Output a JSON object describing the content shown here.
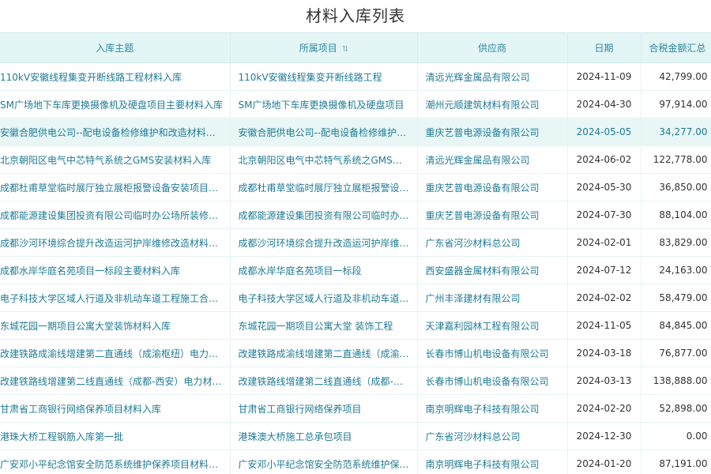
{
  "page": {
    "title": "材料入库列表"
  },
  "table": {
    "headers": {
      "theme": "入库主题",
      "project": "所属项目",
      "supplier": "供应商",
      "date": "日期",
      "amount": "合税金额汇总"
    },
    "sort_icon": "⇅",
    "rows": [
      {
        "theme": "110kV安徽线程集变开断线路工程材料入库",
        "project": "110kV安徽线程集变开断线路工程",
        "supplier": "清远光辉金属品有限公司",
        "date": "2024-11-09",
        "amount": "42,799.00"
      },
      {
        "theme": "SM广场地下车库更换摄像机及硬盘项目主要材料入库",
        "project": "SM广场地下车库更换摄像机及硬盘项目",
        "supplier": "潮州元顺建筑材料有限公司",
        "date": "2024-04-30",
        "amount": "97,914.00"
      },
      {
        "theme": "安徽合肥供电公司--配电设备检修维护和改造材料入库",
        "project": "安徽合肥供电公司--配电设备检修维护和改造",
        "supplier": "重庆艺普电源设备有限公司",
        "date": "2024-05-05",
        "amount": "34,277.00"
      },
      {
        "theme": "北京朝阳区电气中芯特气系统之GMS安装材料入库",
        "project": "北京朝阳区电气中芯特气系统之GMS安装",
        "supplier": "清远光辉金属品有限公司",
        "date": "2024-06-02",
        "amount": "122,778.00"
      },
      {
        "theme": "成都杜甫草堂临时展厅独立展柜报警设备安装项目材料入库",
        "project": "成都杜甫草堂临时展厅独立展柜报警设备安装项目",
        "supplier": "重庆艺普电源设备有限公司",
        "date": "2024-05-30",
        "amount": "36,850.00"
      },
      {
        "theme": "成都能源建设集团投资有限公司临时办公场所装修项目材料入库",
        "project": "成都能源建设集团投资有限公司临时办公场所装修项目",
        "supplier": "重庆艺普电源设备有限公司",
        "date": "2024-07-30",
        "amount": "88,104.00"
      },
      {
        "theme": "成都沙河环境综合提升改造运河护岸维修改造材料入库",
        "project": "成都沙河环境综合提升改造运河护岸维修改造",
        "supplier": "广东省河沙材料总公司",
        "date": "2024-02-01",
        "amount": "83,829.00"
      },
      {
        "theme": "成都水岸华庭名苑项目一标段主要材料入库",
        "project": "成都水岸华庭名苑项目一标段",
        "supplier": "西安盛器金属材料有限公司",
        "date": "2024-07-12",
        "amount": "24,163.00"
      },
      {
        "theme": "电子科技大学区域人行道及非机动车道工程施工合同材料入库",
        "project": "电子科技大学区域人行道及非机动车道工程施工合同",
        "supplier": "广州丰泽建材有限公司",
        "date": "2024-02-02",
        "amount": "58,479.00"
      },
      {
        "theme": "东城花园一期项目公寓大堂装饰材料入库",
        "project": "东城花园一期项目公寓大堂 装饰工程",
        "supplier": "天津嘉利园林工程有限公司",
        "date": "2024-11-05",
        "amount": "84,845.00"
      },
      {
        "theme": "改建铁路成渝线增建第二直通线（成渝枢纽）电力材料入库",
        "project": "改建铁路成渝线增建第二直通线（成渝枢纽）",
        "supplier": "长春市博山机电设备有限公司",
        "date": "2024-03-18",
        "amount": "76,877.00"
      },
      {
        "theme": "改建铁路线增建第二线直通线（成都-西安）电力材料入库",
        "project": "改建铁路线增建第二线直通线（成都-西安）",
        "supplier": "长春市博山机电设备有限公司",
        "date": "2024-03-13",
        "amount": "138,888.00"
      },
      {
        "theme": "甘肃省工商银行网络保养项目材料入库",
        "project": "甘肃省工商银行网络保养项目",
        "supplier": "南京明辉电子科技有限公司",
        "date": "2024-02-20",
        "amount": "52,898.00"
      },
      {
        "theme": "港珠大桥工程钢筋入库第一批",
        "project": "港珠澳大桥施工总承包项目",
        "supplier": "广东省河沙材料总公司",
        "date": "2024-12-30",
        "amount": "0.00"
      },
      {
        "theme": "广安邓小平纪念馆安全防范系统维护保养项目材料入库",
        "project": "广安邓小平纪念馆安全防范系统维护保养项目",
        "supplier": "南京明辉电子科技有限公司",
        "date": "2024-01-20",
        "amount": "87,191.00"
      }
    ]
  }
}
